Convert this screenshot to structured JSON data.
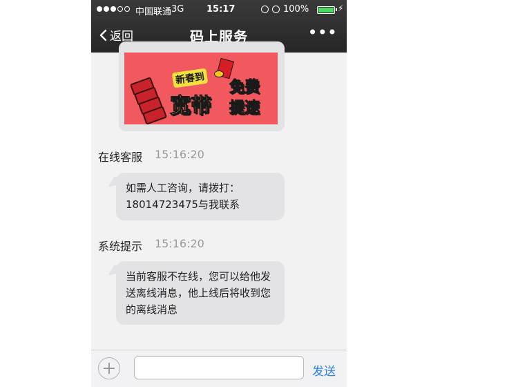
{
  "status_bar": {
    "carrier": "中国联通",
    "network": "3G",
    "time": "15:17",
    "battery": "100%",
    "battery_level": 1.0,
    "icons": [
      "signal-dots-icon",
      "orientation-lock-icon",
      "alarm-icon",
      "battery-icon",
      "charging-bolt-icon"
    ]
  },
  "nav": {
    "back_label": "返回",
    "title": "码上服务",
    "more_icon": "more-dots-icon"
  },
  "banner": {
    "top_text": "新春到",
    "main_text": "宽带",
    "side_text_1": "免费",
    "side_text_2": "提速",
    "bg_color": "#f2595e",
    "text_color": "#f5e33d"
  },
  "messages": [
    {
      "sender": "在线客服",
      "time": "15:16:20",
      "text": "如需人工咨询，请拨打：\n18014723475与我联系"
    },
    {
      "sender": "系统提示",
      "time": "15:16:20",
      "text": "当前客服不在线，您可以给他发送离线消息，他上线后将收到您的离线消息"
    }
  ],
  "input_bar": {
    "add_icon": "plus-circle-icon",
    "placeholder": "",
    "send_label": "发送",
    "send_color": "#2a7fe0"
  }
}
